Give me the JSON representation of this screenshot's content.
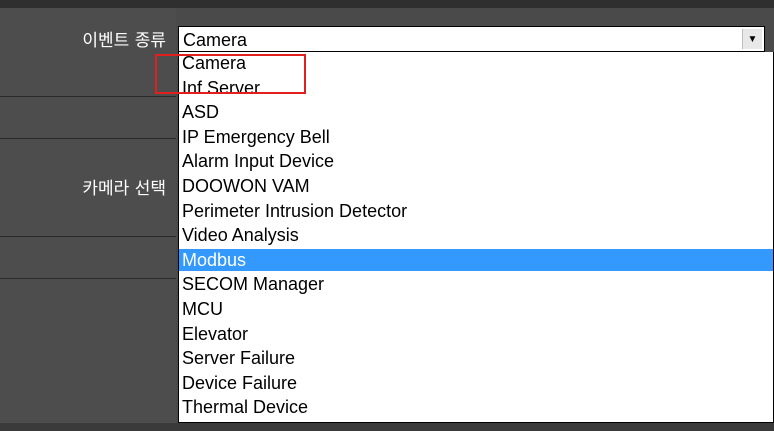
{
  "labels": {
    "event_type": "이벤트 종류",
    "camera_select": "카메라 선택"
  },
  "event_type_select": {
    "value": "Camera",
    "arrow_icon": "chevron-down-icon"
  },
  "dropdown": {
    "options": [
      "Camera",
      "Inf Server",
      "ASD",
      "IP Emergency Bell",
      "Alarm Input Device",
      "DOOWON VAM",
      "Perimeter Intrusion Detector",
      "Video Analysis",
      "Modbus",
      "SECOM Manager",
      "MCU",
      "Elevator",
      "Server Failure",
      "Device Failure",
      "Thermal Device"
    ],
    "selected": "Modbus"
  },
  "colors": {
    "highlight": "#3399ff",
    "annotation_box": "#e02020",
    "panel_bg": "#4d4d4d"
  }
}
